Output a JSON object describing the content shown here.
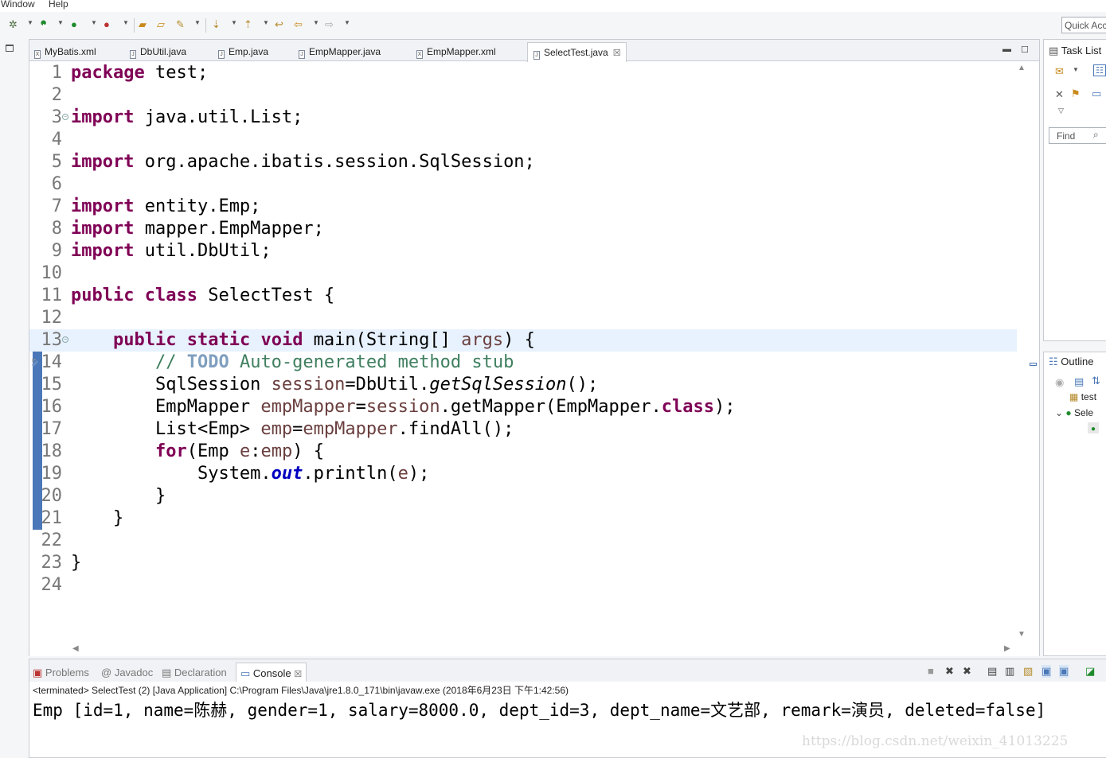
{
  "menu": {
    "window": "Window",
    "help": "Help"
  },
  "quick_access": {
    "placeholder": "Quick Access",
    "visible_text": "Quick Acc"
  },
  "editor": {
    "tabs": [
      {
        "label": "MyBatis.xml",
        "type": "xml"
      },
      {
        "label": "DbUtil.java",
        "type": "java"
      },
      {
        "label": "Emp.java",
        "type": "java"
      },
      {
        "label": "EmpMapper.java",
        "type": "java"
      },
      {
        "label": "EmpMapper.xml",
        "type": "xml"
      },
      {
        "label": "SelectTest.java",
        "type": "java",
        "active": true
      }
    ],
    "close_glyph": "☒",
    "current_line": 13,
    "lines": [
      {
        "n": "1"
      },
      {
        "n": "2"
      },
      {
        "n": "3"
      },
      {
        "n": "4"
      },
      {
        "n": "5"
      },
      {
        "n": "6"
      },
      {
        "n": "7"
      },
      {
        "n": "8"
      },
      {
        "n": "9"
      },
      {
        "n": "10"
      },
      {
        "n": "11"
      },
      {
        "n": "12"
      },
      {
        "n": "13"
      },
      {
        "n": "14"
      },
      {
        "n": "15"
      },
      {
        "n": "16"
      },
      {
        "n": "17"
      },
      {
        "n": "18"
      },
      {
        "n": "19"
      },
      {
        "n": "20"
      },
      {
        "n": "21"
      },
      {
        "n": "22"
      },
      {
        "n": "23"
      },
      {
        "n": "24"
      }
    ],
    "code": {
      "l1": {
        "kw": "package",
        "rest": " test;"
      },
      "l3": {
        "kw": "import",
        "rest": " java.util.List;"
      },
      "l5": {
        "kw": "import",
        "rest": " org.apache.ibatis.session.SqlSession;"
      },
      "l7": {
        "kw": "import",
        "rest": " entity.Emp;"
      },
      "l8": {
        "kw": "import",
        "rest": " mapper.EmpMapper;"
      },
      "l9": {
        "kw": "import",
        "rest": " util.DbUtil;"
      },
      "l11": {
        "kw1": "public",
        "kw2": "class",
        "rest": " SelectTest {"
      },
      "l13": {
        "indent": "    ",
        "kw1": "public",
        "kw2": "static",
        "kw3": "void",
        "t1": " main(String[] ",
        "param": "args",
        "t2": ") {"
      },
      "l14": {
        "indent": "        ",
        "c1": "// ",
        "todo": "TODO",
        "c2": " Auto-generated method stub"
      },
      "l15": {
        "indent": "        ",
        "t1": "SqlSession ",
        "lv": "session",
        "t2": "=DbUtil.",
        "sm": "getSqlSession",
        "t3": "();"
      },
      "l16": {
        "indent": "        ",
        "t1": "EmpMapper ",
        "lv": "empMapper",
        "t2": "=",
        "lv2": "session",
        "t3": ".getMapper(EmpMapper.",
        "kw": "class",
        "t4": ");"
      },
      "l17": {
        "indent": "        ",
        "t1": "List<Emp> ",
        "lv": "emp",
        "t2": "=",
        "lv2": "empMapper",
        "t3": ".findAll();"
      },
      "l18": {
        "indent": "        ",
        "kw": "for",
        "t1": "(Emp ",
        "lv": "e",
        "t2": ":",
        "lv2": "emp",
        "t3": ") {"
      },
      "l19": {
        "indent": "            ",
        "t1": "System.",
        "fld": "out",
        "t2": ".println(",
        "lv": "e",
        "t3": ");"
      },
      "l20": {
        "text": "        }"
      },
      "l21": {
        "text": "    }"
      },
      "l23": {
        "text": "}"
      }
    }
  },
  "console": {
    "tabs": [
      {
        "label": "Problems"
      },
      {
        "label": "Javadoc"
      },
      {
        "label": "Declaration"
      },
      {
        "label": "Console",
        "active": true
      }
    ],
    "status": "<terminated> SelectTest (2) [Java Application] C:\\Program Files\\Java\\jre1.8.0_171\\bin\\javaw.exe (2018年6月23日 下午1:42:56)",
    "output": "Emp [id=1, name=陈赫, gender=1, salary=8000.0, dept_id=3, dept_name=文艺部, remark=演员, deleted=false]",
    "watermark": "https://blog.csdn.net/weixin_41013225"
  },
  "right": {
    "tasklist_label": "Task List",
    "find_label": "Find",
    "outline_label": "Outline",
    "outline_items": [
      "test",
      "Sele"
    ]
  }
}
